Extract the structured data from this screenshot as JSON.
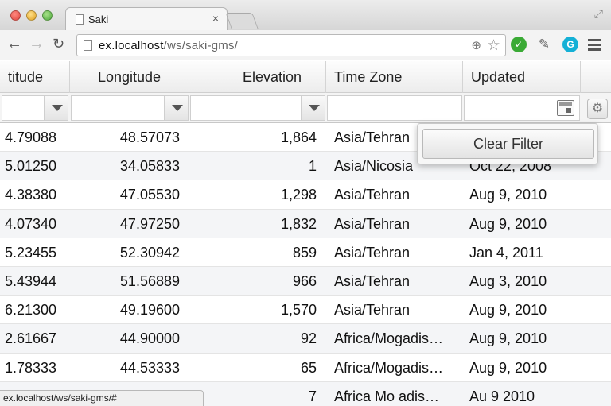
{
  "browser": {
    "tab_title": "Saki",
    "tab_close": "×",
    "url_host": "ex.localhost",
    "url_path": "/ws/saki-gms/",
    "status_url": "ex.localhost/ws/saki-gms/#"
  },
  "grid": {
    "columns": [
      "titude",
      "Longitude",
      "Elevation",
      "Time Zone",
      "Updated"
    ],
    "rows": [
      {
        "lat": "4.79088",
        "lon": "48.57073",
        "elev": "1,864",
        "tz": "Asia/Tehran",
        "updated": ""
      },
      {
        "lat": "5.01250",
        "lon": "34.05833",
        "elev": "1",
        "tz": "Asia/Nicosia",
        "updated": "Oct 22, 2008"
      },
      {
        "lat": "4.38380",
        "lon": "47.05530",
        "elev": "1,298",
        "tz": "Asia/Tehran",
        "updated": "Aug 9, 2010"
      },
      {
        "lat": "4.07340",
        "lon": "47.97250",
        "elev": "1,832",
        "tz": "Asia/Tehran",
        "updated": "Aug 9, 2010"
      },
      {
        "lat": "5.23455",
        "lon": "52.30942",
        "elev": "859",
        "tz": "Asia/Tehran",
        "updated": "Jan 4, 2011"
      },
      {
        "lat": "5.43944",
        "lon": "51.56889",
        "elev": "966",
        "tz": "Asia/Tehran",
        "updated": "Aug 3, 2010"
      },
      {
        "lat": "6.21300",
        "lon": "49.19600",
        "elev": "1,570",
        "tz": "Asia/Tehran",
        "updated": "Aug 9, 2010"
      },
      {
        "lat": "2.61667",
        "lon": "44.90000",
        "elev": "92",
        "tz": "Africa/Mogadis…",
        "updated": "Aug 9, 2010"
      },
      {
        "lat": "1.78333",
        "lon": "44.53333",
        "elev": "65",
        "tz": "Africa/Mogadis…",
        "updated": "Aug 9, 2010"
      },
      {
        "lat": "",
        "lon": "",
        "elev": "7",
        "tz": "Africa Mo adis…",
        "updated": "Au 9 2010"
      }
    ]
  },
  "popup": {
    "clear_filter_label": "Clear Filter"
  },
  "icons": {
    "back": "back-arrow-icon",
    "forward": "forward-arrow-icon",
    "reload": "reload-icon",
    "zoom": "zoom-icon",
    "star": "bookmark-star-icon",
    "menu": "hamburger-menu-icon",
    "settings": "gear-icon"
  }
}
